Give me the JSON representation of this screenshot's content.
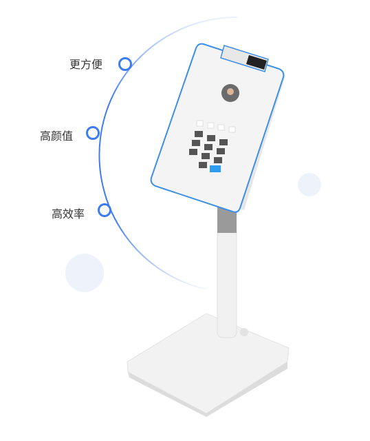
{
  "features": [
    {
      "label": "更方便"
    },
    {
      "label": "高颜值"
    },
    {
      "label": "高效率"
    }
  ],
  "colors": {
    "accent": "#3d7cf0",
    "bubble": "#eef2fb"
  }
}
